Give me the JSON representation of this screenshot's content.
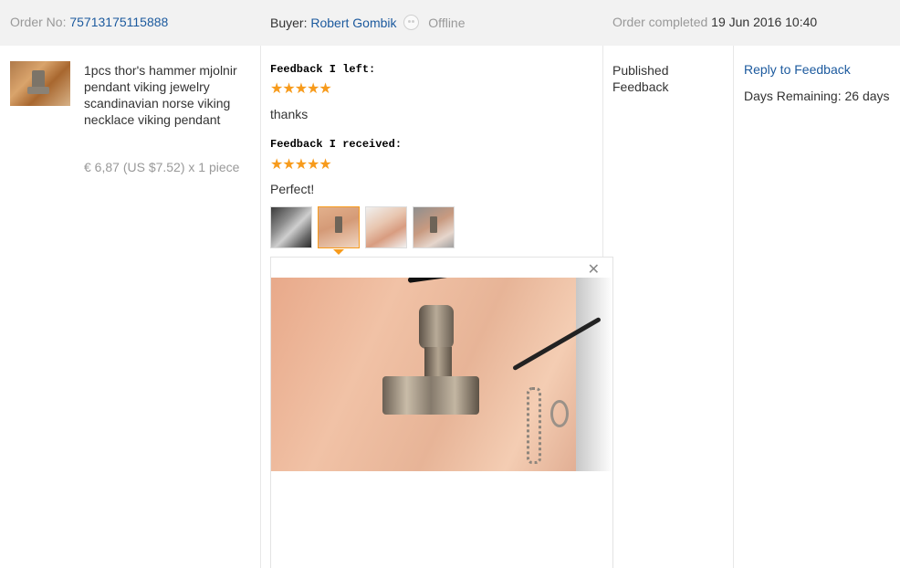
{
  "header": {
    "order_label": "Order No:",
    "order_number": "75713175115888",
    "buyer_label": "Buyer:",
    "buyer_name": "Robert Gombik",
    "buyer_status": "Offline",
    "completed_label": "Order completed",
    "completed_date": "19 Jun 2016 10:40"
  },
  "product": {
    "title": "1pcs thor's hammer mjolnir pendant viking jewelry scandinavian norse viking necklace viking pendant",
    "price": "€ 6,87 (US $7.52) x 1 piece"
  },
  "feedback": {
    "left_label": "Feedback I left:",
    "left_rating": 5,
    "left_text": "thanks",
    "received_label": "Feedback I received:",
    "received_rating": 5,
    "received_text": "Perfect!",
    "stars_glyph": "★★★★★",
    "star_color": "#f79b1c",
    "photo_count": 4,
    "selected_photo": 2
  },
  "status": {
    "text": "Published Feedback"
  },
  "actions": {
    "reply_label": "Reply to Feedback",
    "days_remaining": "Days Remaining: 26 days"
  },
  "colors": {
    "link": "#1c5a9e",
    "header_bg": "#f2f2f2",
    "muted": "#999999"
  }
}
